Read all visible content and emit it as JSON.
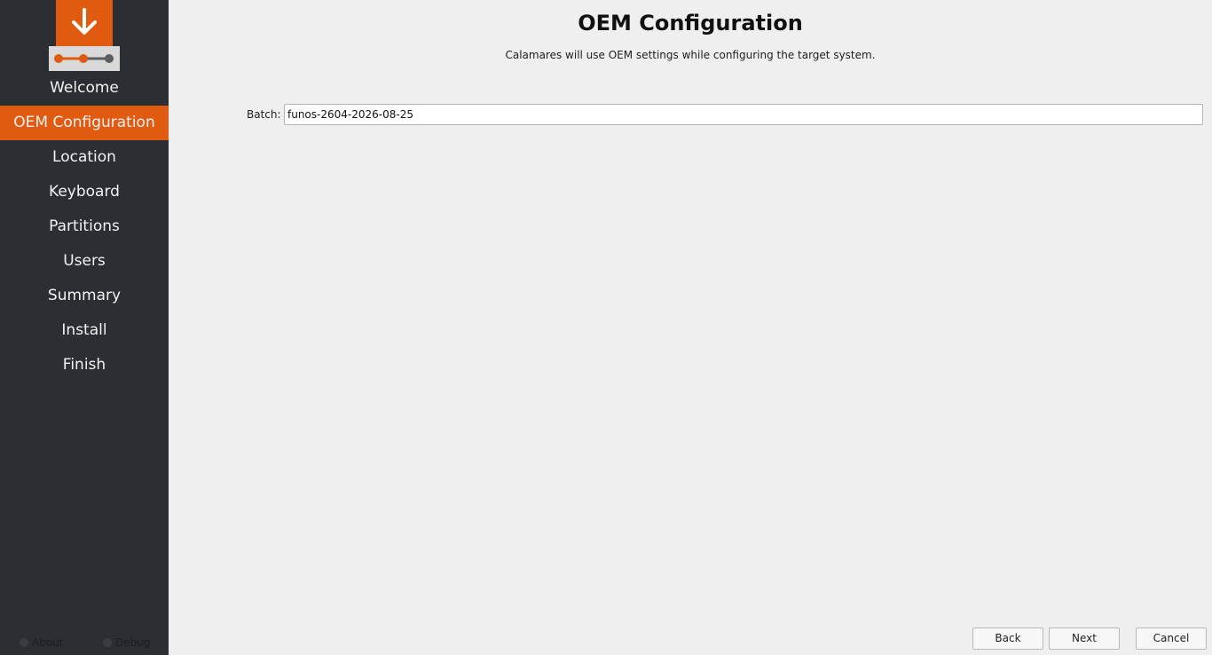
{
  "sidebar": {
    "steps": [
      {
        "label": "Welcome"
      },
      {
        "label": "OEM Configuration"
      },
      {
        "label": "Location"
      },
      {
        "label": "Keyboard"
      },
      {
        "label": "Partitions"
      },
      {
        "label": "Users"
      },
      {
        "label": "Summary"
      },
      {
        "label": "Install"
      },
      {
        "label": "Finish"
      }
    ],
    "active_step": "OEM Configuration",
    "footer": {
      "about_label": "About",
      "debug_label": "Debug"
    }
  },
  "page": {
    "title": "OEM Configuration",
    "subtitle": "Calamares will use OEM settings while configuring the target system."
  },
  "form": {
    "batch_label": "Batch:",
    "batch_value": "funos-2604-2026-08-25"
  },
  "buttons": {
    "back": "Back",
    "next": "Next",
    "cancel": "Cancel"
  },
  "colors": {
    "accent": "#e05a10",
    "sidebar_bg": "#2b2e33",
    "main_bg": "#efefef"
  },
  "icons": {
    "logo": "download-arrow-icon",
    "progress": "progress-dots-icon"
  }
}
